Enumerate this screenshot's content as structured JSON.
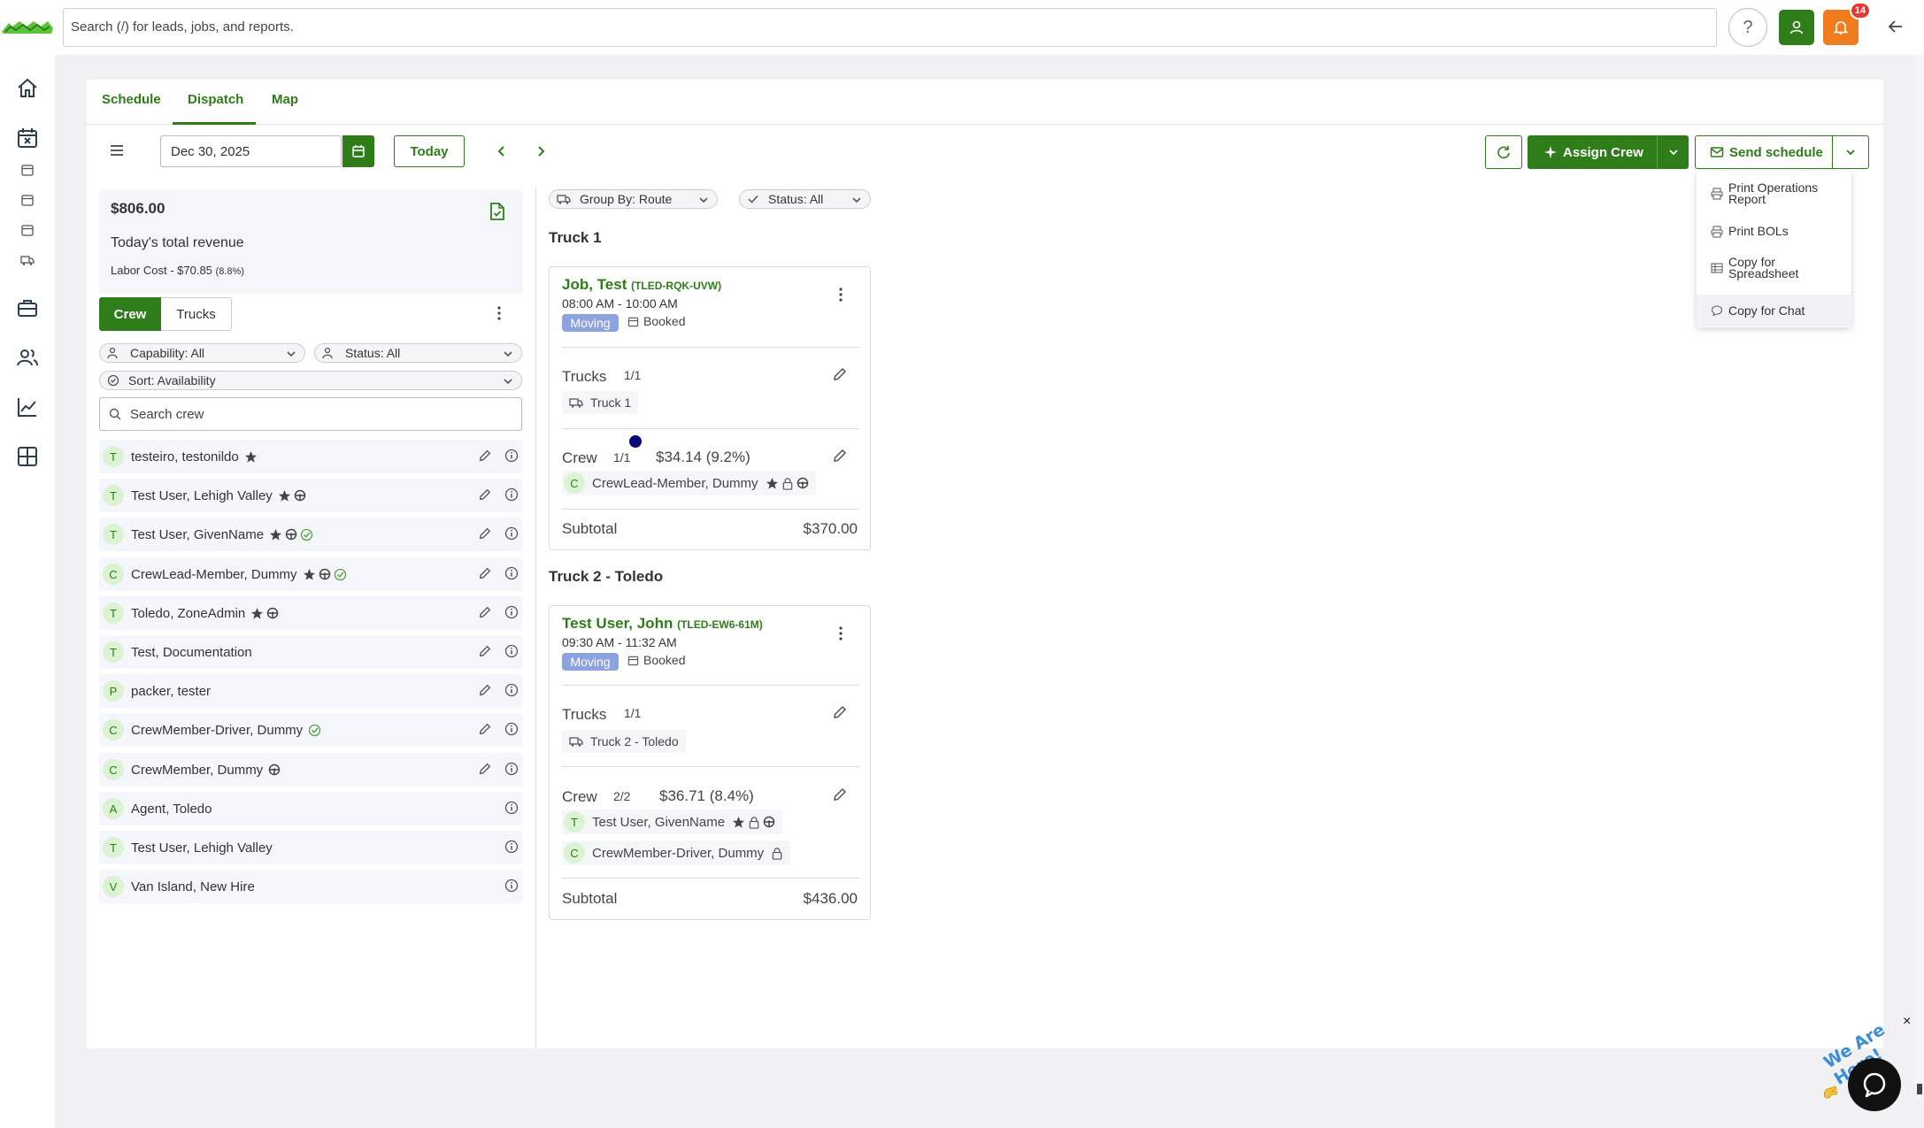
{
  "search": {
    "placeholder": "Search (/) for leads, jobs, and reports."
  },
  "header": {
    "help_label": "?",
    "notification_count": "14"
  },
  "tabs": [
    {
      "label": "Schedule"
    },
    {
      "label": "Dispatch"
    },
    {
      "label": "Map"
    }
  ],
  "toolbar": {
    "date": "Dec 30, 2025",
    "today_label": "Today",
    "assign_crew_label": "Assign Crew",
    "send_schedule_label": "Send schedule"
  },
  "dropdown": {
    "items": [
      {
        "label": "Print Operations Report",
        "icon": "printer-icon"
      },
      {
        "label": "Print BOLs",
        "icon": "printer-icon"
      },
      {
        "label": "Copy for Spreadsheet",
        "icon": "table-icon"
      },
      {
        "label": "Copy for Chat",
        "icon": "chat-icon"
      }
    ]
  },
  "revenue": {
    "amount": "$806.00",
    "label": "Today's total revenue",
    "labor_cost": "Labor Cost - $70.85",
    "labor_pct": "(8.8%)"
  },
  "crew_panel": {
    "toggle": [
      "Crew",
      "Trucks"
    ],
    "capability_filter": "Capability: All",
    "status_filter": "Status: All",
    "sort": "Sort: Availability",
    "search_placeholder": "Search crew",
    "members": [
      {
        "initial": "T",
        "name": "testeiro, testonildo",
        "badges": [
          "star"
        ],
        "editable": true
      },
      {
        "initial": "T",
        "name": "Test User, Lehigh Valley",
        "badges": [
          "star",
          "steering"
        ],
        "editable": true
      },
      {
        "initial": "T",
        "name": "Test User, GivenName",
        "badges": [
          "star",
          "steering",
          "check"
        ],
        "editable": true
      },
      {
        "initial": "C",
        "name": "CrewLead-Member, Dummy",
        "badges": [
          "star",
          "steering",
          "check"
        ],
        "editable": true
      },
      {
        "initial": "T",
        "name": "Toledo, ZoneAdmin",
        "badges": [
          "star",
          "steering"
        ],
        "editable": true
      },
      {
        "initial": "T",
        "name": "Test, Documentation",
        "badges": [],
        "editable": true
      },
      {
        "initial": "P",
        "name": "packer, tester",
        "badges": [],
        "editable": true
      },
      {
        "initial": "C",
        "name": "CrewMember-Driver, Dummy",
        "badges": [
          "check"
        ],
        "editable": true
      },
      {
        "initial": "C",
        "name": "CrewMember, Dummy",
        "badges": [
          "steering"
        ],
        "editable": true
      },
      {
        "initial": "A",
        "name": "Agent, Toledo",
        "badges": [],
        "editable": false
      },
      {
        "initial": "T",
        "name": "Test User, Lehigh Valley",
        "badges": [],
        "editable": false
      },
      {
        "initial": "V",
        "name": "Van Island, New Hire",
        "badges": [],
        "editable": false
      }
    ]
  },
  "routes_header": {
    "group_by": "Group By: Route",
    "status": "Status: All"
  },
  "routes": [
    {
      "title": "Truck 1",
      "job": {
        "name": "Job, Test",
        "code": "(TLED-RQK-UVW)",
        "time": "08:00 AM - 10:00 AM",
        "type": "Moving",
        "status": "Booked",
        "trucks_label": "Trucks",
        "trucks_count": "1/1",
        "trucks": [
          "Truck 1"
        ],
        "crew_label": "Crew",
        "crew_count": "1/1",
        "crew_cost": "$34.14 (9.2%)",
        "crew": [
          {
            "initial": "C",
            "name": "CrewLead-Member, Dummy"
          }
        ],
        "subtotal_label": "Subtotal",
        "subtotal": "$370.00"
      }
    },
    {
      "title": "Truck 2 - Toledo",
      "job": {
        "name": "Test User, John",
        "code": "(TLED-EW6-61M)",
        "time": "09:30 AM - 11:32 AM",
        "type": "Moving",
        "status": "Booked",
        "trucks_label": "Trucks",
        "trucks_count": "1/1",
        "trucks": [
          "Truck 2 - Toledo"
        ],
        "crew_label": "Crew",
        "crew_count": "2/2",
        "crew_cost": "$36.71 (8.4%)",
        "crew": [
          {
            "initial": "T",
            "name": "Test User, GivenName"
          },
          {
            "initial": "C",
            "name": "CrewMember-Driver, Dummy"
          }
        ],
        "subtotal_label": "Subtotal",
        "subtotal": "$436.00"
      }
    }
  ],
  "chat_widget": {
    "label": "We Are Here!"
  },
  "colors": {
    "brand_green": "#2e7d1a",
    "moving_tag": "#8ca3e0",
    "alert_orange": "#f07c1e",
    "badge_red": "#e53935"
  }
}
